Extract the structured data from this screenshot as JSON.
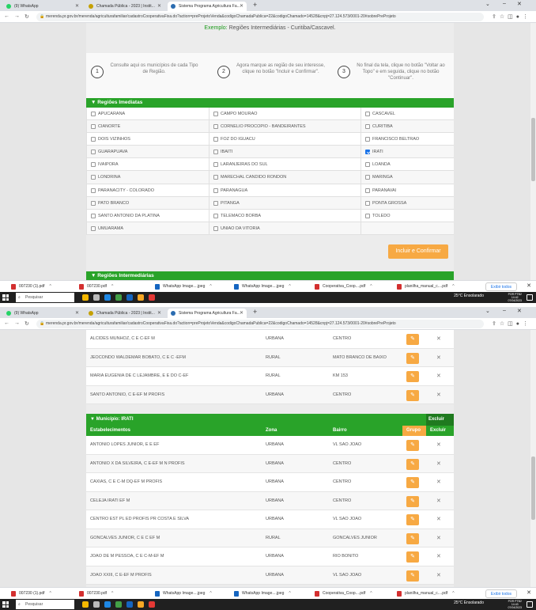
{
  "browser": {
    "tabs": [
      {
        "label": "(9) WhatsApp"
      },
      {
        "label": "Chamada Pública - 2023 | Instit..."
      },
      {
        "label": "Sistema Programa Agricultura Fa..."
      }
    ],
    "url": "merenda.pr.gov.br/merenda/agriculturafamiliar/cadastroCooperativaFixa.do?action=preProjetoVenda&codigoChamadaPublica=22&codigoChamado=14528&cnpj=27.124.573/0001-20#sobrePreProjeto"
  },
  "downloads": {
    "items": [
      {
        "label": "007230 (1).pdf"
      },
      {
        "label": "007230.pdf"
      },
      {
        "label": "WhatsApp Image....jpeg"
      },
      {
        "label": "WhatsApp Image....jpeg"
      },
      {
        "label": "Cooperativa_Coop....pdf"
      },
      {
        "label": "planilha_manual_c....pdf"
      }
    ],
    "show_all": "Exibir todos"
  },
  "taskbar": {
    "search_placeholder": "Pesquisar",
    "weather": "25°C Ensolarado",
    "lang": "POR PTB2",
    "time_1": "14:42",
    "time_2": "14:43",
    "date": "07/04/2023"
  },
  "page1": {
    "example_label": "Exemplo:",
    "example_text": "Regiões Intermediárias - Curitiba/Cascavel.",
    "steps": [
      {
        "num": "1",
        "text": "Consulte aqui os municípios de cada Tipo de Região."
      },
      {
        "num": "2",
        "text": "Agora marque as região de seu interesse, clique no botão \"Incluir e Confirmar\"."
      },
      {
        "num": "3",
        "text": "No final da tela, clique no botão \"Voltar ao Topo\" e em seguida, clique no botão \"Continuar\"."
      }
    ],
    "section_imediatas": "▼ Regiões Imediatas",
    "regions": [
      [
        "APUCARANA",
        "CAMPO MOURAO",
        "CASCAVEL"
      ],
      [
        "CIANORTE",
        "CORNELIO PROCOPIO - BANDEIRANTES",
        "CURITIBA"
      ],
      [
        "DOIS VIZINHOS",
        "FOZ DO IGUACU",
        "FRANCISCO BELTRAO"
      ],
      [
        "GUARAPUAVA",
        "IBAITI",
        "IRATI"
      ],
      [
        "IVAIPORA",
        "LARANJEIRAS DO SUL",
        "LOANDA"
      ],
      [
        "LONDRINA",
        "MARECHAL CANDIDO RONDON",
        "MARINGA"
      ],
      [
        "PARANACITY - COLORADO",
        "PARANAGUA",
        "PARANAVAI"
      ],
      [
        "PATO BRANCO",
        "PITANGA",
        "PONTA GROSSA"
      ],
      [
        "SANTO ANTONIO DA PLATINA",
        "TELEMACO BORBA",
        "TOLEDO"
      ],
      [
        "UMUARAMA",
        "UNIAO DA VITORIA",
        ""
      ]
    ],
    "checked": "IRATI",
    "incluir_button": "Incluir e Confirmar",
    "section_intermediarias": "▼ Regiões Intermediárias"
  },
  "page2": {
    "top_rows": [
      {
        "nome": "ALCIDES MUNHOZ, C E C-EF M",
        "zona": "URBANA",
        "bairro": "CENTRO"
      },
      {
        "nome": "JEOCONDO WALDEMAR BOBATO, C E C -EFM",
        "zona": "RURAL",
        "bairro": "MATO BRANCO DE BAIXO"
      },
      {
        "nome": "MARIA EUGENIA DE C LEJAMBRE, E E DO C-EF",
        "zona": "RURAL",
        "bairro": "KM 153"
      },
      {
        "nome": "SANTO ANTONIO, C E-EF M PROFIS",
        "zona": "URBANA",
        "bairro": "CENTRO"
      }
    ],
    "municipio": "▼ Município: IRATI",
    "excluir": "Excluir",
    "headers": {
      "estab": "Estabelecimentos",
      "zona": "Zona",
      "bairro": "Bairro",
      "grupo": "Grupo",
      "excluir": "Excluir"
    },
    "rows": [
      {
        "nome": "ANTONIO LOPES JUNIOR, E E EF",
        "zona": "URBANA",
        "bairro": "VL SAO JOAO"
      },
      {
        "nome": "ANTONIO X DA SILVEIRA, C E-EF M N PROFIS",
        "zona": "URBANA",
        "bairro": "CENTRO"
      },
      {
        "nome": "CAXIAS, C E C-M DQ-EF M PROFIS",
        "zona": "URBANA",
        "bairro": "CENTRO"
      },
      {
        "nome": "CELEJA IRATI EF M",
        "zona": "URBANA",
        "bairro": "CENTRO"
      },
      {
        "nome": "CENTRO EST PL ED PROFIS PR COSTA E SILVA",
        "zona": "URBANA",
        "bairro": "VL SAO JOAO"
      },
      {
        "nome": "GONCALVES JUNIOR, C E C EF M",
        "zona": "RURAL",
        "bairro": "GONCALVES JUNIOR"
      },
      {
        "nome": "JOAO DE M PESSOA, C E C-M-EF M",
        "zona": "URBANA",
        "bairro": "RIO BONITO"
      },
      {
        "nome": "JOAO XXIII, C E-EF M PROFIS",
        "zona": "URBANA",
        "bairro": "VL SAO JOAO"
      }
    ]
  },
  "icons": {
    "pencil": "✎",
    "close": "✕"
  }
}
